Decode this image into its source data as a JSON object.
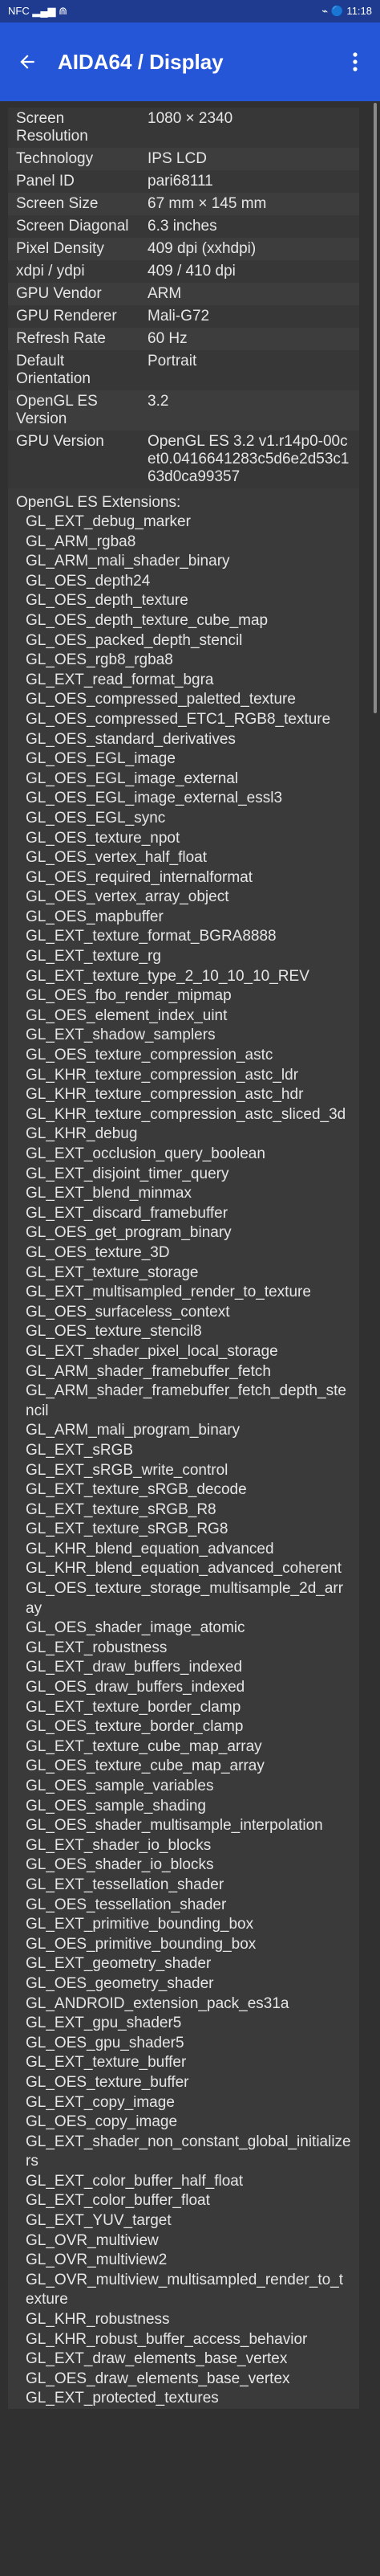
{
  "status": {
    "left": "NFC  ▂▄▆  ⋒",
    "right": "⌁ 🔵 11:18"
  },
  "app": {
    "title": "AIDA64 / Display"
  },
  "rows": [
    {
      "label": "Screen Resolution",
      "value": "1080 × 2340"
    },
    {
      "label": "Technology",
      "value": "IPS LCD"
    },
    {
      "label": "Panel ID",
      "value": "pari68111"
    },
    {
      "label": "Screen Size",
      "value": "67 mm × 145 mm"
    },
    {
      "label": "Screen Diagonal",
      "value": "6.3 inches"
    },
    {
      "label": "Pixel Density",
      "value": "409 dpi (xxhdpi)"
    },
    {
      "label": "xdpi / ydpi",
      "value": "409 / 410 dpi"
    },
    {
      "label": "GPU Vendor",
      "value": "ARM"
    },
    {
      "label": "GPU Renderer",
      "value": "Mali-G72"
    },
    {
      "label": "Refresh Rate",
      "value": "60 Hz"
    },
    {
      "label": "Default Orientation",
      "value": "Portrait"
    },
    {
      "label": "OpenGL ES Version",
      "value": "3.2"
    },
    {
      "label": "GPU Version",
      "value": "OpenGL ES 3.2 v1.r14p0-00cet0.0416641283c5d6e2d53c163d0ca99357"
    }
  ],
  "extensions_label": "OpenGL ES Extensions:",
  "extensions": [
    "GL_EXT_debug_marker",
    "GL_ARM_rgba8",
    "GL_ARM_mali_shader_binary",
    "GL_OES_depth24",
    "GL_OES_depth_texture",
    "GL_OES_depth_texture_cube_map",
    "GL_OES_packed_depth_stencil",
    "GL_OES_rgb8_rgba8",
    "GL_EXT_read_format_bgra",
    "GL_OES_compressed_paletted_texture",
    "GL_OES_compressed_ETC1_RGB8_texture",
    "GL_OES_standard_derivatives",
    "GL_OES_EGL_image",
    "GL_OES_EGL_image_external",
    "GL_OES_EGL_image_external_essl3",
    "GL_OES_EGL_sync",
    "GL_OES_texture_npot",
    "GL_OES_vertex_half_float",
    "GL_OES_required_internalformat",
    "GL_OES_vertex_array_object",
    "GL_OES_mapbuffer",
    "GL_EXT_texture_format_BGRA8888",
    "GL_EXT_texture_rg",
    "GL_EXT_texture_type_2_10_10_10_REV",
    "GL_OES_fbo_render_mipmap",
    "GL_OES_element_index_uint",
    "GL_EXT_shadow_samplers",
    "GL_OES_texture_compression_astc",
    "GL_KHR_texture_compression_astc_ldr",
    "GL_KHR_texture_compression_astc_hdr",
    "GL_KHR_texture_compression_astc_sliced_3d",
    "GL_KHR_debug",
    "GL_EXT_occlusion_query_boolean",
    "GL_EXT_disjoint_timer_query",
    "GL_EXT_blend_minmax",
    "GL_EXT_discard_framebuffer",
    "GL_OES_get_program_binary",
    "GL_OES_texture_3D",
    "GL_EXT_texture_storage",
    "GL_EXT_multisampled_render_to_texture",
    "GL_OES_surfaceless_context",
    "GL_OES_texture_stencil8",
    "GL_EXT_shader_pixel_local_storage",
    "GL_ARM_shader_framebuffer_fetch",
    "GL_ARM_shader_framebuffer_fetch_depth_stencil",
    "GL_ARM_mali_program_binary",
    "GL_EXT_sRGB",
    "GL_EXT_sRGB_write_control",
    "GL_EXT_texture_sRGB_decode",
    "GL_EXT_texture_sRGB_R8",
    "GL_EXT_texture_sRGB_RG8",
    "GL_KHR_blend_equation_advanced",
    "GL_KHR_blend_equation_advanced_coherent",
    "GL_OES_texture_storage_multisample_2d_array",
    "GL_OES_shader_image_atomic",
    "GL_EXT_robustness",
    "GL_EXT_draw_buffers_indexed",
    "GL_OES_draw_buffers_indexed",
    "GL_EXT_texture_border_clamp",
    "GL_OES_texture_border_clamp",
    "GL_EXT_texture_cube_map_array",
    "GL_OES_texture_cube_map_array",
    "GL_OES_sample_variables",
    "GL_OES_sample_shading",
    "GL_OES_shader_multisample_interpolation",
    "GL_EXT_shader_io_blocks",
    "GL_OES_shader_io_blocks",
    "GL_EXT_tessellation_shader",
    "GL_OES_tessellation_shader",
    "GL_EXT_primitive_bounding_box",
    "GL_OES_primitive_bounding_box",
    "GL_EXT_geometry_shader",
    "GL_OES_geometry_shader",
    "GL_ANDROID_extension_pack_es31a",
    "GL_EXT_gpu_shader5",
    "GL_OES_gpu_shader5",
    "GL_EXT_texture_buffer",
    "GL_OES_texture_buffer",
    "GL_EXT_copy_image",
    "GL_OES_copy_image",
    "GL_EXT_shader_non_constant_global_initializers",
    "GL_EXT_color_buffer_half_float",
    "GL_EXT_color_buffer_float",
    "GL_EXT_YUV_target",
    "GL_OVR_multiview",
    "GL_OVR_multiview2",
    "GL_OVR_multiview_multisampled_render_to_texture",
    "GL_KHR_robustness",
    "GL_KHR_robust_buffer_access_behavior",
    "GL_EXT_draw_elements_base_vertex",
    "GL_OES_draw_elements_base_vertex",
    "GL_EXT_protected_textures"
  ]
}
